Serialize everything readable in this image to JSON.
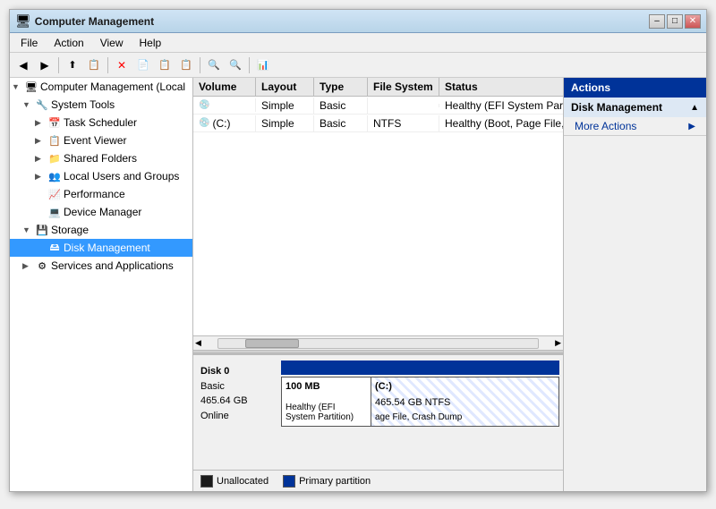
{
  "window": {
    "title": "Computer Management",
    "buttons": {
      "minimize": "–",
      "maximize": "□",
      "close": "✕"
    }
  },
  "menu": {
    "items": [
      "File",
      "Action",
      "View",
      "Help"
    ]
  },
  "toolbar": {
    "icons": [
      "←",
      "→",
      "⬆",
      "📋",
      "🔍",
      "✕",
      "📄",
      "📋",
      "🔍",
      "🔍",
      "📊"
    ]
  },
  "tree": {
    "root": "Computer Management (Local",
    "system_tools": "System Tools",
    "task_scheduler": "Task Scheduler",
    "event_viewer": "Event Viewer",
    "shared_folders": "Shared Folders",
    "local_users": "Local Users and Groups",
    "performance": "Performance",
    "device_manager": "Device Manager",
    "storage": "Storage",
    "disk_management": "Disk Management",
    "services": "Services and Applications"
  },
  "table": {
    "headers": [
      "Volume",
      "Layout",
      "Type",
      "File System",
      "Status"
    ],
    "rows": [
      {
        "volume": "",
        "layout": "Simple",
        "type": "Basic",
        "fs": "",
        "status": "Healthy (EFI System Partition)"
      },
      {
        "volume": "(C:)",
        "layout": "Simple",
        "type": "Basic",
        "fs": "NTFS",
        "status": "Healthy (Boot, Page File, Crash Du"
      }
    ]
  },
  "disk": {
    "name": "Disk 0",
    "type": "Basic",
    "size": "465.64 GB",
    "status": "Online",
    "partitions": [
      {
        "label": "",
        "size": "100 MB",
        "fs": "",
        "description": "Healthy (EFI System Partition)"
      },
      {
        "label": "(C:)",
        "size": "465.54 GB NTFS",
        "description": "age File, Crash Dump"
      }
    ]
  },
  "legend": {
    "items": [
      {
        "label": "Unallocated",
        "color": "#1a1a1a"
      },
      {
        "label": "Primary partition",
        "color": "#003399"
      }
    ]
  },
  "actions": {
    "title": "Actions",
    "sections": [
      {
        "label": "Disk Management",
        "items": [
          "More Actions"
        ]
      }
    ]
  }
}
